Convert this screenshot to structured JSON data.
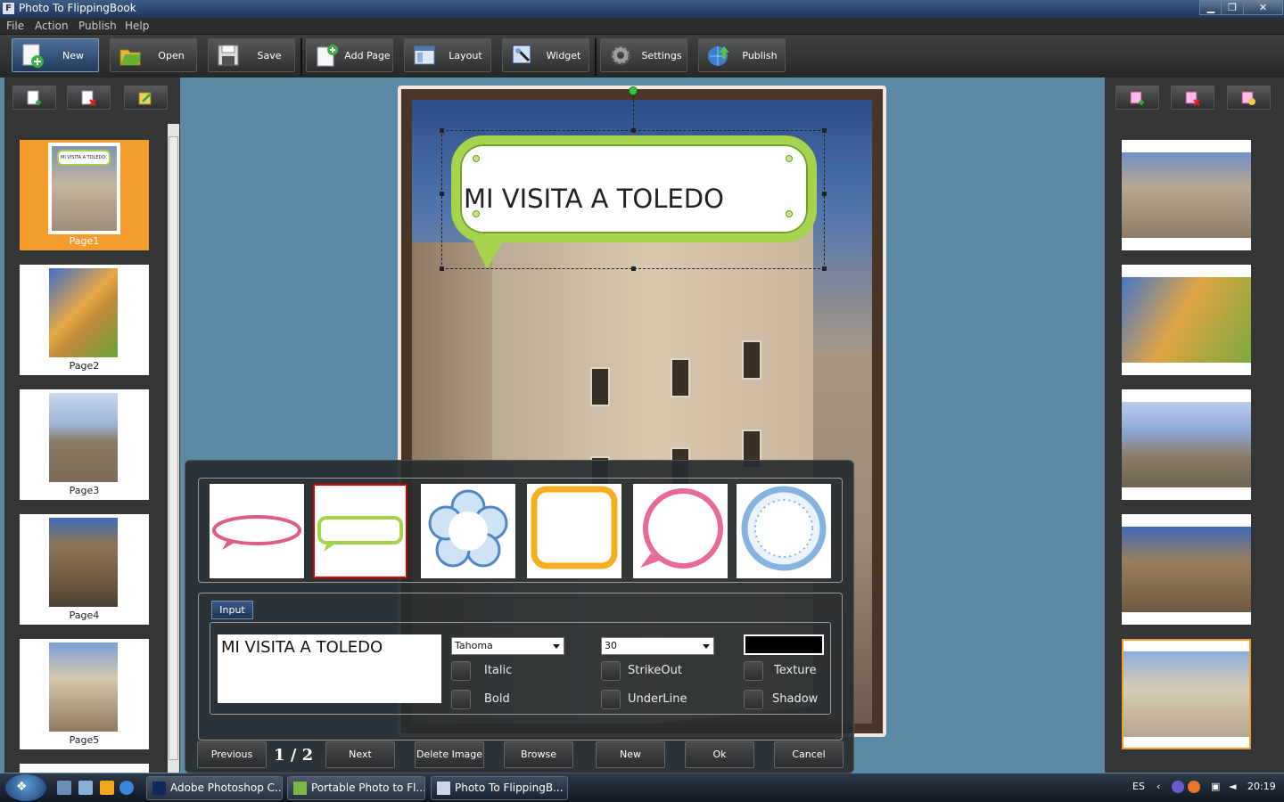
{
  "window": {
    "title": "Photo To FlippingBook",
    "app_icon": "F",
    "minimize": "▁",
    "restore": "❐",
    "close": "✕"
  },
  "menu": [
    "File",
    "Action",
    "Publish",
    "Help"
  ],
  "toolbar": {
    "new": "New",
    "open": "Open",
    "save": "Save",
    "add_page": "Add Page",
    "layout": "Layout",
    "widget": "Widget",
    "settings": "Settings",
    "publish": "Publish"
  },
  "left_pages": [
    "Page1",
    "Page2",
    "Page3",
    "Page4",
    "Page5"
  ],
  "bubble_text": "MI VISITA A TOLEDO",
  "dialog": {
    "input_tab": "Input",
    "text_value": "MI VISITA A TOLEDO",
    "font": "Tahoma",
    "size": "30",
    "italic": "Italic",
    "bold": "Bold",
    "strikeout": "StrikeOut",
    "underline": "UnderLine",
    "texture": "Texture",
    "shadow": "Shadow",
    "previous": "Previous",
    "page_current": "1",
    "page_sep": "/",
    "page_total": "2",
    "next": "Next",
    "delete_image": "Delete Image",
    "browse": "Browse",
    "new": "New",
    "ok": "Ok",
    "cancel": "Cancel"
  },
  "taskbar": {
    "tasks": [
      "Adobe Photoshop C...",
      "Portable Photo to Fl...",
      "Photo To FlippingB..."
    ],
    "lang": "ES",
    "clock": "20:19"
  },
  "colors": {
    "accent_orange": "#f49c2c",
    "bubble_green": "#a5d34b",
    "background": "#5b8aa6"
  }
}
